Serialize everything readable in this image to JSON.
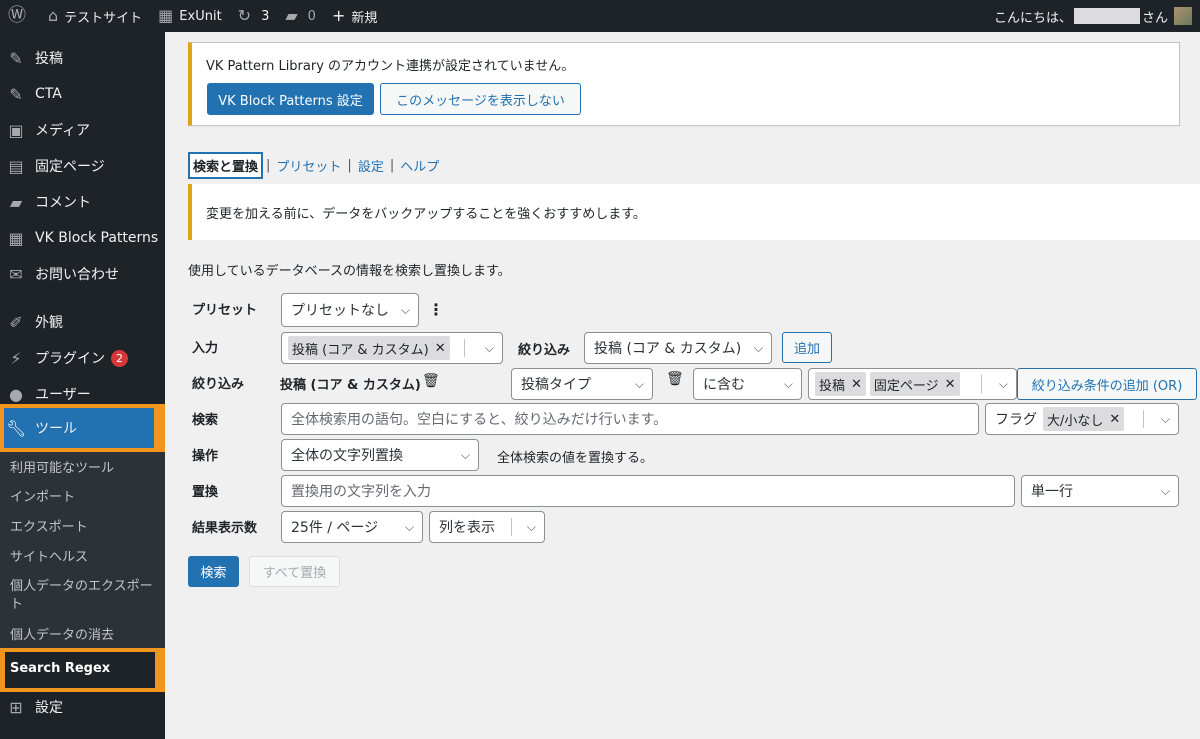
{
  "adminbar": {
    "site_name": "テストサイト",
    "exunit": "ExUnit",
    "updates_count": "3",
    "comments_count": "0",
    "new_label": "新規",
    "greeting_prefix": "こんにちは、",
    "greeting_suffix": "さん",
    "icons": {
      "wp": "wordpress-logo-icon",
      "home": "home-icon",
      "exunit": "exunit-icon",
      "updates": "refresh-icon",
      "comments": "comment-icon",
      "new": "plus-icon"
    }
  },
  "sidebar": {
    "items": [
      {
        "label": "投稿",
        "icon": "pin-icon"
      },
      {
        "label": "CTA",
        "icon": "pin-icon"
      },
      {
        "label": "メディア",
        "icon": "media-icon"
      },
      {
        "label": "固定ページ",
        "icon": "page-icon"
      },
      {
        "label": "コメント",
        "icon": "comment-icon"
      },
      {
        "label": "VK Block Patterns",
        "icon": "grid-icon"
      },
      {
        "label": "お問い合わせ",
        "icon": "mail-icon"
      },
      {
        "label": "外観",
        "icon": "brush-icon"
      },
      {
        "label": "プラグイン",
        "icon": "plugin-icon",
        "badge": "2"
      },
      {
        "label": "ユーザー",
        "icon": "user-icon"
      },
      {
        "label": "ツール",
        "icon": "wrench-icon"
      },
      {
        "label": "設定",
        "icon": "settings-icon"
      }
    ],
    "submenu": [
      "利用可能なツール",
      "インポート",
      "エクスポート",
      "サイトヘルス",
      "個人データのエクスポート",
      "個人データの消去",
      "Search Regex"
    ],
    "highlight_color": "#f0951f",
    "active_color": "#2271b1"
  },
  "notice": {
    "message": "VK Pattern Library のアカウント連携が設定されていません。",
    "primary_button": "VK Block Patterns 設定",
    "secondary_button": "このメッセージを表示しない"
  },
  "tabs": {
    "current": "検索と置換",
    "links": [
      "プリセット",
      "設定",
      "ヘルプ"
    ],
    "separator": "|"
  },
  "warning": "変更を加える前に、データをバックアップすることを強くおすすめします。",
  "intro": "使用しているデータベースの情報を検索し置換します。",
  "form": {
    "preset": {
      "label": "プリセット",
      "value": "プリセットなし",
      "more": "⋮"
    },
    "source": {
      "label": "入力",
      "tag": "投稿 (コア & カスタム)",
      "filter_label": "絞り込み",
      "filter_value": "投稿 (コア & カスタム)",
      "add_button": "追加"
    },
    "filter": {
      "label": "絞り込み",
      "group": "投稿 (コア & カスタム)",
      "column": "投稿タイプ",
      "logic": "に含む",
      "tags": [
        "投稿",
        "固定ページ"
      ],
      "add_or_button": "絞り込み条件の追加 (OR)"
    },
    "search": {
      "label": "検索",
      "placeholder": "全体検索用の語句。空白にすると、絞り込みだけ行います。",
      "flags_label": "フラグ",
      "flag_tag": "大/小なし"
    },
    "action": {
      "label": "操作",
      "value": "全体の文字列置換",
      "description": "全体検索の値を置換する。"
    },
    "replace": {
      "label": "置換",
      "placeholder": "置換用の文字列を入力",
      "mode": "単一行"
    },
    "results": {
      "label": "結果表示数",
      "per_page": "25件 / ページ",
      "columns": "列を表示"
    }
  },
  "buttons": {
    "search": "検索",
    "replace_all": "すべて置換"
  }
}
